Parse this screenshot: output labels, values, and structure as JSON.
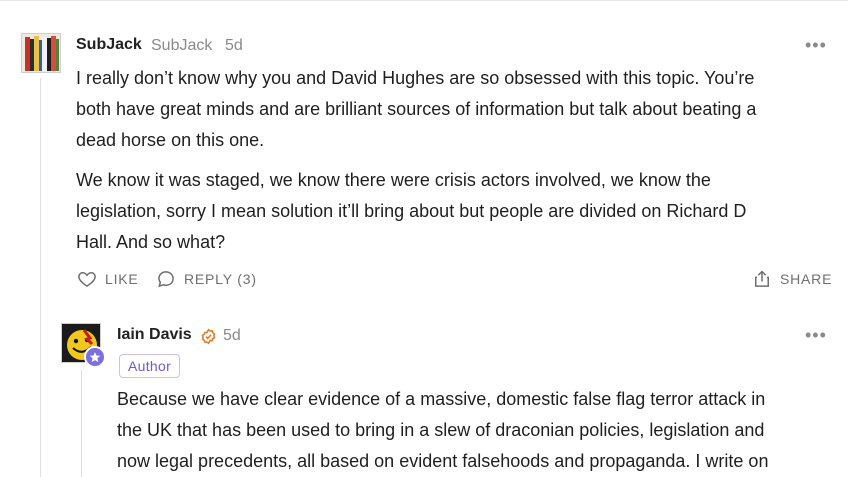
{
  "comment1": {
    "author": "SubJack",
    "handle": "SubJack",
    "time": "5d",
    "more_icon": "ellipsis-icon",
    "lines_p1": [
      "I really don’t know why you and David Hughes are so obsessed with this topic. You’re",
      "both have great minds and are brilliant sources of information but talk about beating a",
      "dead horse on this one."
    ],
    "lines_p2": [
      "We know it was staged, we know there were crisis actors involved, we know the",
      "legislation, sorry I mean solution it’ll bring about but people are divided on Richard D",
      "Hall. And so what?"
    ],
    "actions": {
      "like_label": "LIKE",
      "reply_label": "REPLY (3)",
      "share_label": "SHARE"
    }
  },
  "reply1": {
    "author": "Iain Davis",
    "time": "5d",
    "badge": "Author",
    "lines": [
      "Because we have clear evidence of a massive, domestic false flag terror attack in",
      "the UK that has been used to bring in a slew of draconian policies, legislation and",
      "now legal precedents, all based on evident falsehoods and propaganda. I write on"
    ]
  },
  "colors": {
    "accent_purple": "#6a5bd6",
    "verified_orange": "#e07b2a",
    "muted": "#8a8a8a"
  }
}
